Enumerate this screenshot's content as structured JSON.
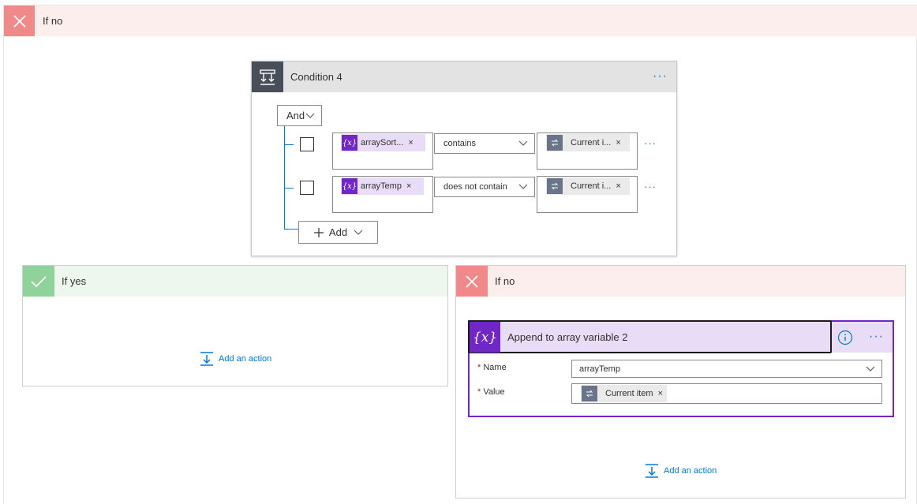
{
  "outer_branch": {
    "label": "If no"
  },
  "condition": {
    "title": "Condition 4",
    "group_operator": "And",
    "rows": [
      {
        "left_token": "arraySort...",
        "operator": "contains",
        "right_token": "Current i..."
      },
      {
        "left_token": "arrayTemp",
        "operator": "does not contain",
        "right_token": "Current i..."
      }
    ],
    "add_label": "Add"
  },
  "if_yes": {
    "label": "If yes",
    "add_action": "Add an action"
  },
  "if_no": {
    "label": "If no",
    "add_action": "Add an action",
    "action": {
      "title": "Append to array variable 2",
      "fields": {
        "name_label": "Name",
        "name_value": "arrayTemp",
        "value_label": "Value",
        "value_token": "Current item",
        "required_marker": "*"
      }
    }
  },
  "colors": {
    "accent": "#0078d4",
    "no_header": "#fdeeee",
    "no_icon": "#f08a8a",
    "yes_header": "#eef7ee",
    "yes_icon": "#8fd39a",
    "variable_purple": "#7126c8"
  },
  "icons": [
    "close-icon",
    "condition-icon",
    "more-icon",
    "variable-icon",
    "loop-icon",
    "chevron-down-icon",
    "plus-icon",
    "check-icon",
    "info-icon",
    "add-action-icon"
  ]
}
